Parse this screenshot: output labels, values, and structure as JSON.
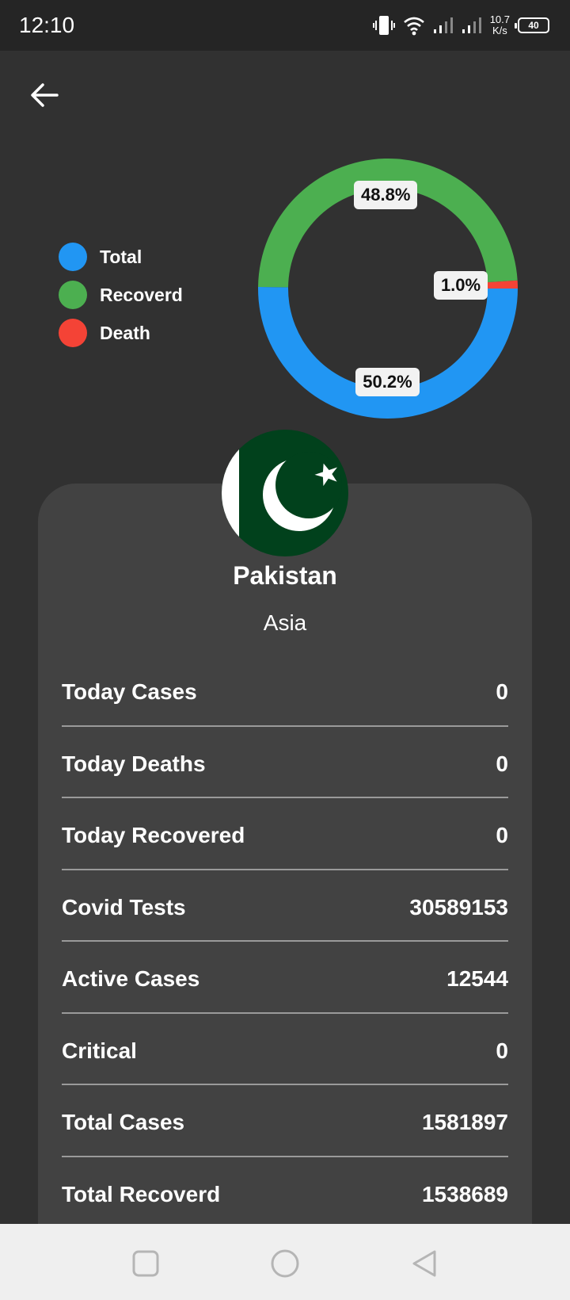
{
  "status_bar": {
    "time": "12:10",
    "net_speed_value": "10.7",
    "net_speed_unit": "K/s",
    "battery": "40",
    "icons": [
      "vibrate-icon",
      "wifi-icon",
      "signal-icon",
      "signal-icon",
      "battery-icon"
    ]
  },
  "header": {
    "back_icon": "arrow-left-icon"
  },
  "legend": [
    {
      "label": "Total",
      "color": "#2196F3"
    },
    {
      "label": "Recoverd",
      "color": "#4CAF50"
    },
    {
      "label": "Death",
      "color": "#F44336"
    }
  ],
  "chart_data": {
    "type": "pie",
    "style": "donut",
    "labels": [
      "Total",
      "Recoverd",
      "Death"
    ],
    "values": [
      50.2,
      48.8,
      1.0
    ],
    "value_labels": [
      "50.2%",
      "48.8%",
      "1.0%"
    ],
    "colors": [
      "#2196F3",
      "#4CAF50",
      "#F44336"
    ],
    "start_direction": "right, clockwise",
    "title": ""
  },
  "country": {
    "name": "Pakistan",
    "continent": "Asia",
    "flag_colors": {
      "green": "#01411C",
      "white": "#FFFFFF"
    }
  },
  "stats": [
    {
      "label": "Today Cases",
      "value": "0"
    },
    {
      "label": "Today Deaths",
      "value": "0"
    },
    {
      "label": "Today Recovered",
      "value": "0"
    },
    {
      "label": "Covid Tests",
      "value": "30589153"
    },
    {
      "label": "Active Cases",
      "value": "12544"
    },
    {
      "label": "Critical",
      "value": "0"
    },
    {
      "label": "Total Cases",
      "value": "1581897"
    },
    {
      "label": "Total Recoverd",
      "value": "1538689"
    }
  ],
  "nav_bar": {
    "icons": [
      "square-recents-icon",
      "circle-home-icon",
      "triangle-back-icon"
    ]
  }
}
